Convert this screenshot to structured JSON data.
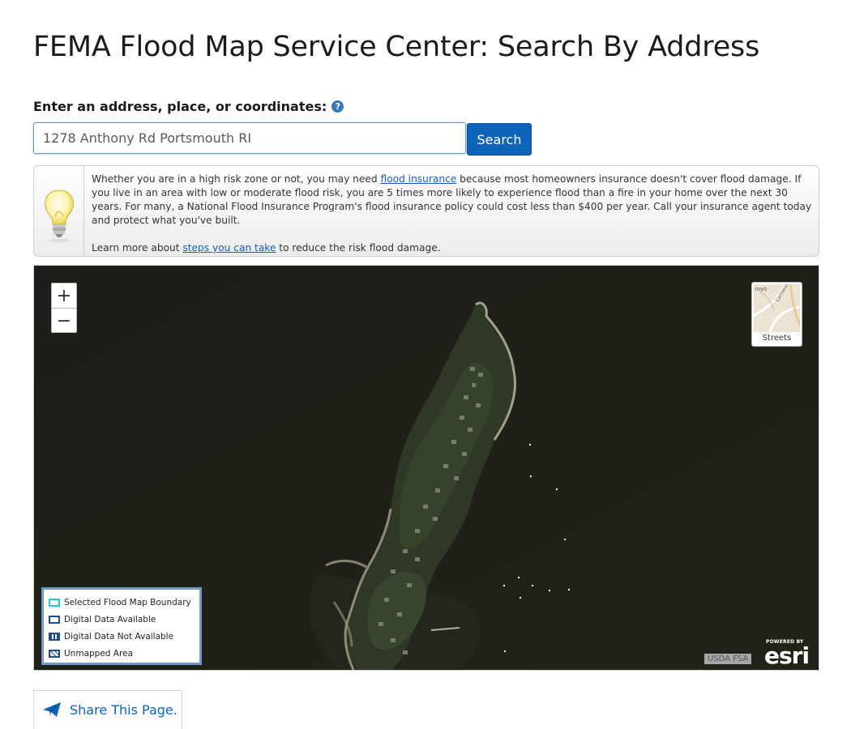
{
  "page": {
    "title": "FEMA Flood Map Service Center: Search By Address"
  },
  "search": {
    "label": "Enter an address, place, or coordinates:",
    "help_icon": "question-circle-icon",
    "value": "1278 Anthony Rd Portsmouth RI",
    "button_label": "Search"
  },
  "info": {
    "icon": "lightbulb-icon",
    "para1_before": "Whether you are in a high risk zone or not, you may need ",
    "para1_link": "flood insurance",
    "para1_after": " because most homeowners insurance doesn't cover flood damage. If you live in an area with low or moderate flood risk, you are 5 times more likely to experience flood than a fire in your home over the next 30 years. For many, a National Flood Insurance Program's flood insurance policy could cost less than $400 per year. Call your insurance agent today and protect what you've built.",
    "para2_before": "Learn more about ",
    "para2_link": "steps you can take",
    "para2_after": " to reduce the risk flood damage."
  },
  "map": {
    "zoom_in": "+",
    "zoom_out": "−",
    "basemap_label": "Streets",
    "attribution": "USDA FSA",
    "logo_powered": "POWERED BY",
    "logo_word": "esri",
    "legend": [
      {
        "label": "Selected Flood Map Boundary",
        "swatch": "cyan-outline"
      },
      {
        "label": "Digital Data Available",
        "swatch": "blue-outline"
      },
      {
        "label": "Digital Data Not Available",
        "swatch": "blue-dotted"
      },
      {
        "label": "Unmapped Area",
        "swatch": "blue-hatched"
      }
    ],
    "colors": {
      "water": "#1e1e19",
      "legend_border": "#6e9cc7",
      "cyan": "#22c6e6",
      "blue": "#1f4e8c"
    }
  },
  "share": {
    "icon": "paper-plane-icon",
    "label": "Share This Page."
  }
}
